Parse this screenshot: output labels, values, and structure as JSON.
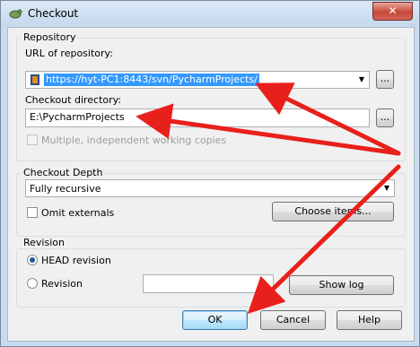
{
  "window": {
    "title": "Checkout",
    "close_glyph": "✕"
  },
  "repository": {
    "group_label": "Repository",
    "url_label": "URL of repository:",
    "url_value": "https://hyt-PC1:8443/svn/PycharmProjects/",
    "browse_label": "...",
    "dir_label": "Checkout directory:",
    "dir_value": "E:\\PycharmProjects",
    "dir_browse_label": "...",
    "multiple_label": "Multiple, independent working copies"
  },
  "depth": {
    "group_label": "Checkout Depth",
    "selected": "Fully recursive",
    "omit_label": "Omit externals",
    "choose_items_label": "Choose items..."
  },
  "revision": {
    "group_label": "Revision",
    "head_label": "HEAD revision",
    "revision_label": "Revision",
    "revision_value": "",
    "show_log_label": "Show log"
  },
  "footer": {
    "ok_label": "OK",
    "cancel_label": "Cancel",
    "help_label": "Help"
  },
  "annotations": {
    "arrow_color": "#e8201c"
  }
}
